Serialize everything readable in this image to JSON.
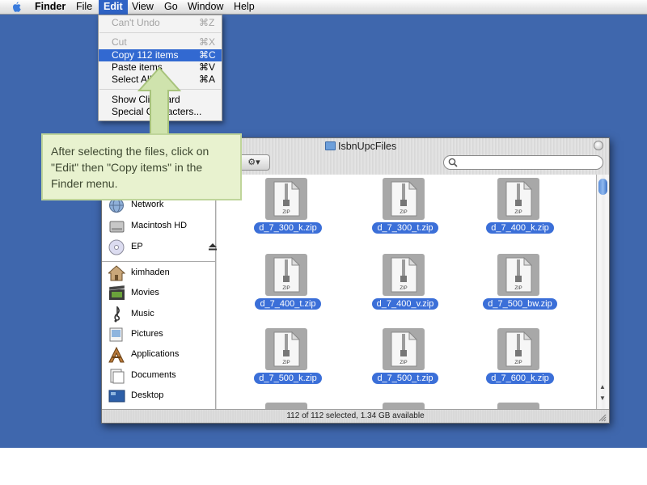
{
  "menubar": {
    "items": [
      {
        "label": "Finder"
      },
      {
        "label": "File"
      },
      {
        "label": "Edit"
      },
      {
        "label": "View"
      },
      {
        "label": "Go"
      },
      {
        "label": "Window"
      },
      {
        "label": "Help"
      }
    ],
    "active_menu": "Edit"
  },
  "edit_menu": {
    "items": [
      {
        "label": "Can't Undo",
        "shortcut": "⌘Z",
        "enabled": false
      },
      {
        "label": "Cut",
        "shortcut": "⌘X",
        "enabled": false
      },
      {
        "label": "Copy 112 items",
        "shortcut": "⌘C",
        "enabled": true,
        "highlighted": true
      },
      {
        "label": "Paste items",
        "shortcut": "⌘V",
        "enabled": true
      },
      {
        "label": "Select All",
        "shortcut": "⌘A",
        "enabled": true
      },
      {
        "label": "Show Clipboard",
        "shortcut": "",
        "enabled": true
      },
      {
        "label": "Special Characters...",
        "shortcut": "",
        "enabled": true
      }
    ]
  },
  "callout": {
    "text": "After selecting the files, click on \"Edit\" then \"Copy items\" in the Finder menu."
  },
  "window": {
    "title": "IsbnUpcFiles",
    "status": "112 of 112 selected, 1.34 GB available",
    "action_button": "⚙▾"
  },
  "sidebar": {
    "devices": [
      {
        "label": "Network",
        "icon": "globe-icon"
      },
      {
        "label": "Macintosh HD",
        "icon": "hard-drive-icon"
      },
      {
        "label": "EP",
        "icon": "disc-icon"
      }
    ],
    "places": [
      {
        "label": "kimhaden",
        "icon": "home-icon"
      },
      {
        "label": "Movies",
        "icon": "film-icon"
      },
      {
        "label": "Music",
        "icon": "music-icon"
      },
      {
        "label": "Pictures",
        "icon": "pictures-icon"
      },
      {
        "label": "Applications",
        "icon": "applications-icon"
      },
      {
        "label": "Documents",
        "icon": "documents-icon"
      },
      {
        "label": "Desktop",
        "icon": "desktop-icon"
      }
    ]
  },
  "files": {
    "icon_label": "ZIP",
    "items": [
      {
        "name": "d_7_300_k.zip"
      },
      {
        "name": "d_7_300_t.zip"
      },
      {
        "name": "d_7_400_k.zip"
      },
      {
        "name": "d_7_400_t.zip"
      },
      {
        "name": "d_7_400_v.zip"
      },
      {
        "name": "d_7_500_bw.zip"
      },
      {
        "name": "d_7_500_k.zip"
      },
      {
        "name": "d_7_500_t.zip"
      },
      {
        "name": "d_7_600_k.zip"
      }
    ]
  },
  "colors": {
    "desktop": "#3f67ad",
    "selection": "#3b6fd8",
    "menu_highlight": "#3269d1",
    "callout_bg": "#e8f2cf"
  }
}
